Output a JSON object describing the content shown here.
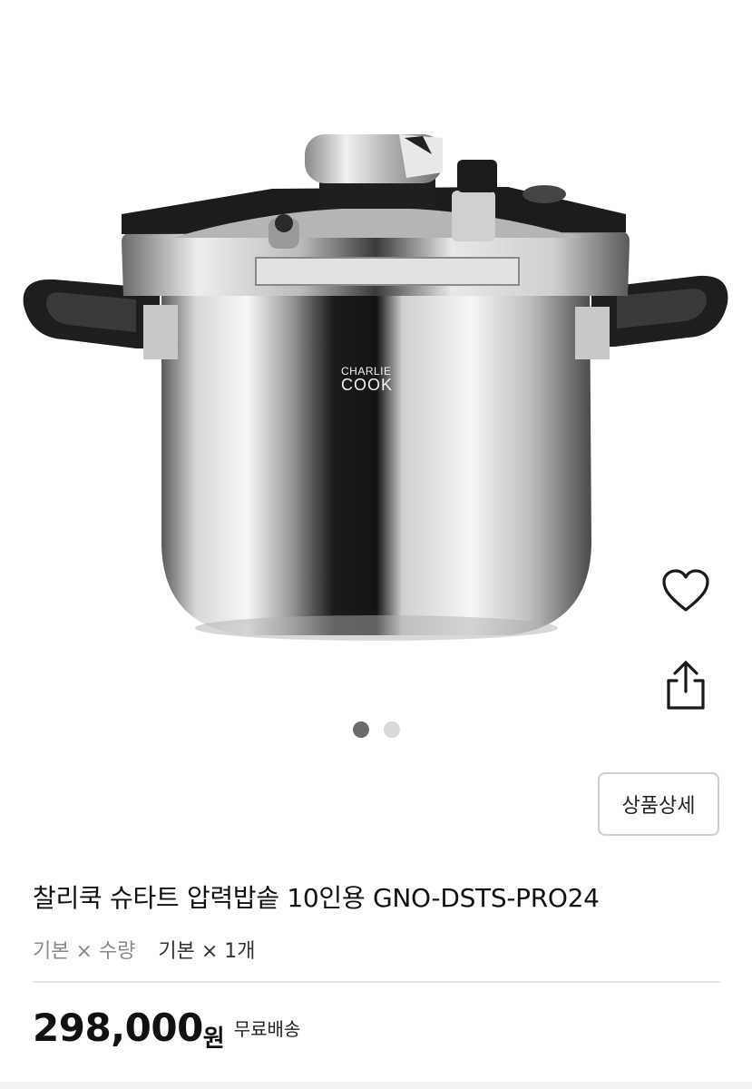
{
  "product": {
    "brand_logo_line1": "CHARLIE",
    "brand_logo_line2": "COOK",
    "title": "찰리쿡 슈타트 압력밥솥 10인용 GNO-DSTS-PRO24",
    "option_label": "기본 × 수량",
    "option_value": "기본 × 1개",
    "price": "298,000",
    "currency": "원",
    "shipping": "무료배송"
  },
  "actions": {
    "wishlist_icon": "heart-icon",
    "share_icon": "share-icon",
    "detail_button_label": "상품상세"
  },
  "gallery": {
    "total_images": 2,
    "current_index": 1
  },
  "colors": {
    "dot_active": "#6b6b6b",
    "dot_inactive": "#d9d9d9",
    "border": "#cfcfcf"
  }
}
